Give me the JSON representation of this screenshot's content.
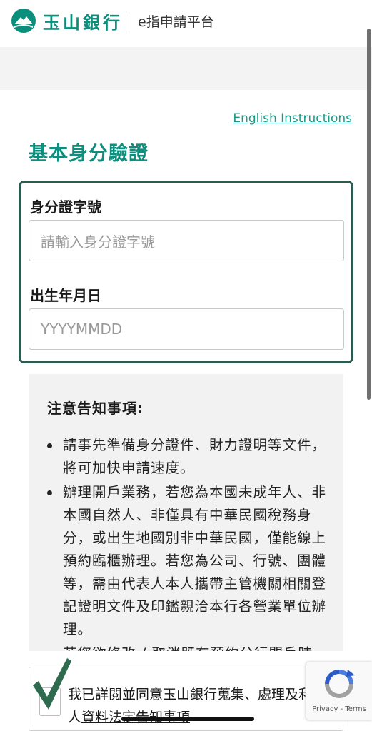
{
  "header": {
    "bank_name": "玉山銀行",
    "platform_name": "e指申請平台"
  },
  "english_link": "English Instructions",
  "section_title": "基本身分驗證",
  "form": {
    "id_label": "身分證字號",
    "id_placeholder": "請輸入身分證字號",
    "id_value": "",
    "dob_label": "出生年月日",
    "dob_placeholder": "YYYYMMDD",
    "dob_value": ""
  },
  "notice": {
    "title": "注意告知事項:",
    "items": [
      "請事先準備身分證件、財力證明等文件，將可加快申請速度。",
      "辦理開戶業務，若您為本國未成年人、非本國自然人、非僅具有中華民國稅務身分，或出生地國別非中華民國，僅能線上預約臨櫃辦理。若您為公司、行號、團體等，需由代表人本人攜帶主管機關相關登記證明文件及印鑑親洽本行各營業單位辦理。",
      "若您欲修改 / 取消既有預約分行開戶時"
    ]
  },
  "agreement": {
    "checked": true,
    "text_prefix": "我已詳閱並同意玉山銀行蒐集、處理及利用個人",
    "link_text": "資料法定告知事項"
  },
  "recaptcha": {
    "text": "Privacy - Terms"
  },
  "colors": {
    "brand": "#0a8f7d",
    "form_border": "#2a5d50",
    "check_mark": "#2e6b4f"
  }
}
